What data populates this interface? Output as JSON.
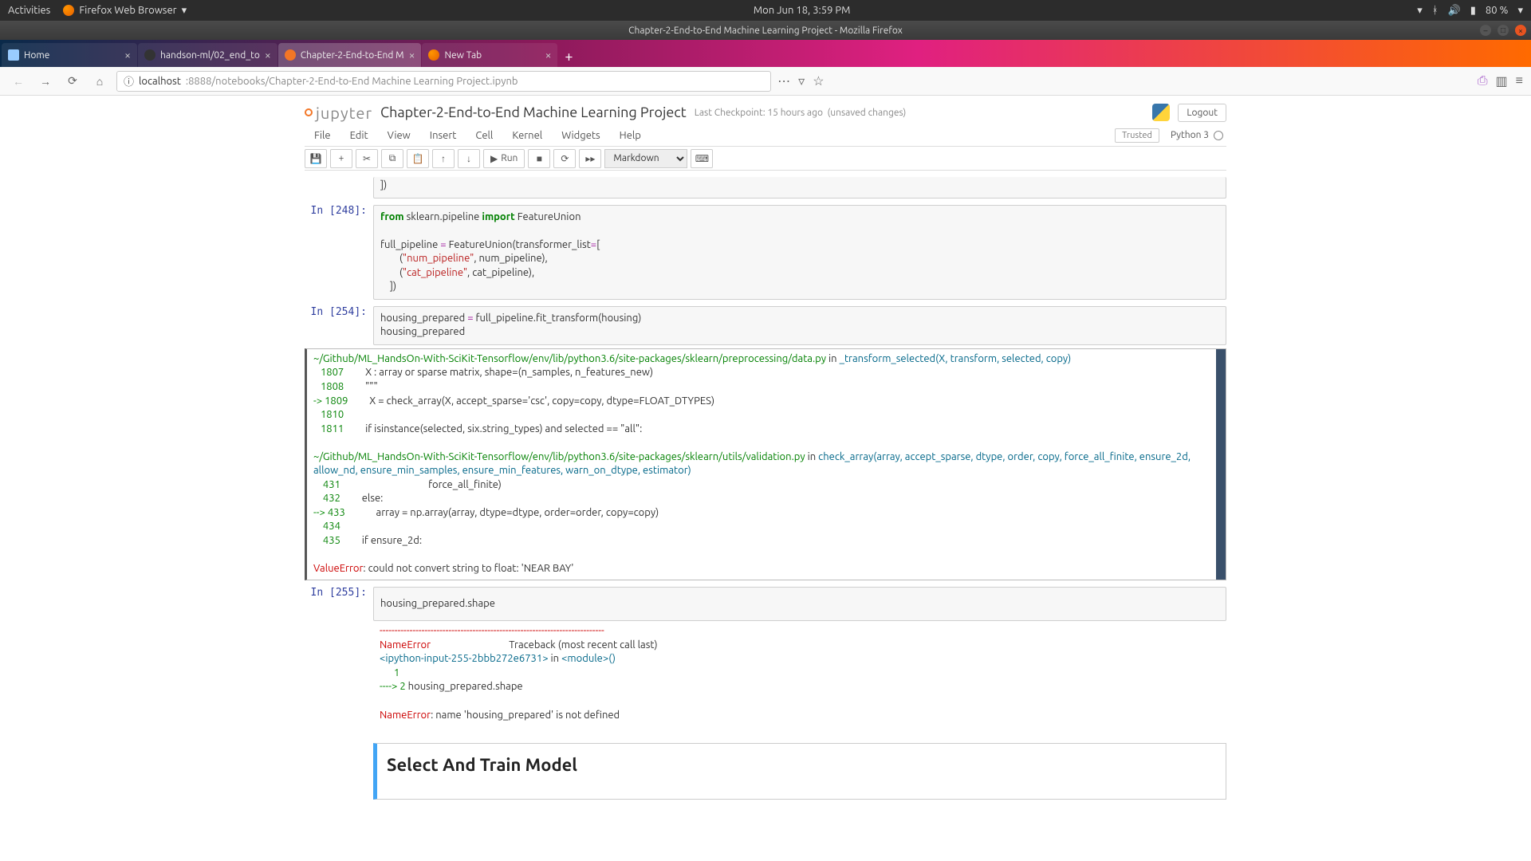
{
  "gnome": {
    "activities": "Activities",
    "app": "Firefox Web Browser",
    "clock": "Mon Jun 18,  3:59 PM",
    "battery": "80 %"
  },
  "firefox": {
    "window_title": "Chapter-2-End-to-End Machine Learning Project - Mozilla Firefox",
    "tabs": [
      {
        "label": "Home"
      },
      {
        "label": "handson-ml/02_end_to"
      },
      {
        "label": "Chapter-2-End-to-End M"
      },
      {
        "label": "New Tab"
      }
    ],
    "url_host": "localhost",
    "url_path": ":8888/notebooks/Chapter-2-End-to-End Machine Learning Project.ipynb"
  },
  "jupyter": {
    "logo_text": "jupyter",
    "title": "Chapter-2-End-to-End Machine Learning Project",
    "checkpoint": "Last Checkpoint: 15 hours ago",
    "unsaved": "(unsaved changes)",
    "logout": "Logout",
    "menus": [
      "File",
      "Edit",
      "View",
      "Insert",
      "Cell",
      "Kernel",
      "Widgets",
      "Help"
    ],
    "trusted": "Trusted",
    "kernel": "Python 3",
    "run_label": "Run",
    "celltype": "Markdown"
  },
  "cells": {
    "c0_end": "])",
    "c1_prompt": "In [248]:",
    "c1_l1a": "from",
    "c1_l1b": " sklearn.pipeline ",
    "c1_l1c": "import",
    "c1_l1d": " FeatureUnion",
    "c1_l2": "",
    "c1_l3a": "full_pipeline ",
    "c1_l3b": "=",
    "c1_l3c": " FeatureUnion(transformer_list",
    "c1_l3d": "=",
    "c1_l3e": "[",
    "c1_l4a": "        (",
    "c1_l4b": "\"num_pipeline\"",
    "c1_l4c": ", num_pipeline),",
    "c1_l5a": "        (",
    "c1_l5b": "\"cat_pipeline\"",
    "c1_l5c": ", cat_pipeline),",
    "c1_l6": "    ])",
    "c2_prompt": "In [254]:",
    "c2_l1a": "housing_prepared ",
    "c2_l1b": "=",
    "c2_l1c": " full_pipeline.fit_transform(housing)",
    "c2_l2": "housing_prepared",
    "tb1_file": "~/Github/ML_HandsOn-With-SciKit-Tensorflow/env/lib/python3.6/site-packages/sklearn/preprocessing/data.py",
    "tb1_in": " in ",
    "tb1_func": "_transform_selected",
    "tb1_args": "(X, transform, selected, copy)",
    "tb1_1807": "   1807 ",
    "tb1_1807b": "        X : array ",
    "tb1_1807c": "or",
    "tb1_1807d": " sparse matrix, shape",
    "tb1_1807e": "=",
    "tb1_1807f": "(n_samples, n_features_new)",
    "tb1_1808": "   1808 ",
    "tb1_1808b": "        \"\"\"",
    "tb1_1809a": "-> ",
    "tb1_1809": "1809 ",
    "tb1_1809b": "        X ",
    "tb1_1809c": "=",
    "tb1_1809d": " check_array(X, accept_sparse",
    "tb1_1809e": "=",
    "tb1_1809f": "'csc'",
    "tb1_1809g": ", copy",
    "tb1_1809h": "=",
    "tb1_1809i": "copy, dtype",
    "tb1_1809j": "=",
    "tb1_1809k": "FLOAT_DTYPES)",
    "tb1_1810": "   1810 ",
    "tb1_1811": "   1811 ",
    "tb1_1811b": "        ",
    "tb1_1811c": "if",
    "tb1_1811d": " isinstance(selected, six.string_types) ",
    "tb1_1811e": "and",
    "tb1_1811f": " selected ",
    "tb1_1811g": "==",
    "tb1_1811h": " ",
    "tb1_1811i": "\"all\"",
    "tb1_1811j": ":",
    "tb2_file": "~/Github/ML_HandsOn-With-SciKit-Tensorflow/env/lib/python3.6/site-packages/sklearn/utils/validation.py",
    "tb2_in": " in ",
    "tb2_func": "check_array",
    "tb2_args": "(array, accept_sparse, dtype, order, copy, force_all_finite, ensure_2d, allow_nd, ensure_min_samples, ensure_min_features, warn_on_dtype, estimator)",
    "tb2_431": "    431 ",
    "tb2_431b": "                                    force_all_finite)",
    "tb2_432": "    432 ",
    "tb2_432b": "        ",
    "tb2_432c": "else",
    "tb2_432d": ":",
    "tb2_433a": "--> ",
    "tb2_433": "433 ",
    "tb2_433b": "            array ",
    "tb2_433c": "=",
    "tb2_433d": " np.array(array, dtype",
    "tb2_433e": "=",
    "tb2_433f": "dtype, order",
    "tb2_433g": "=",
    "tb2_433h": "order, copy",
    "tb2_433i": "=",
    "tb2_433j": "copy)",
    "tb2_434": "    434 ",
    "tb2_435": "    435 ",
    "tb2_435b": "        ",
    "tb2_435c": "if",
    "tb2_435d": " ensure_2d:",
    "tb_err": "ValueError",
    "tb_err_msg": ": could not convert string to float: 'NEAR BAY'",
    "c3_prompt": "In [255]:",
    "c3_l1": "housing_prepared.shape",
    "ne_dash": "---------------------------------------------------------------------------",
    "ne_name": "NameError",
    "ne_trace": "                                 Traceback (most recent call last)",
    "ne_file": "<ipython-input-255-2bbb272e6731>",
    "ne_in": " in ",
    "ne_mod": "<module>",
    "ne_par": "()",
    "ne_l1": "      1",
    "ne_l2a": "----> ",
    "ne_l2b": "2",
    "ne_l2c": " housing_prepared.shape",
    "ne_name2": "NameError",
    "ne_msg": ": name 'housing_prepared' is not defined",
    "md_title": "Select And Train Model"
  }
}
